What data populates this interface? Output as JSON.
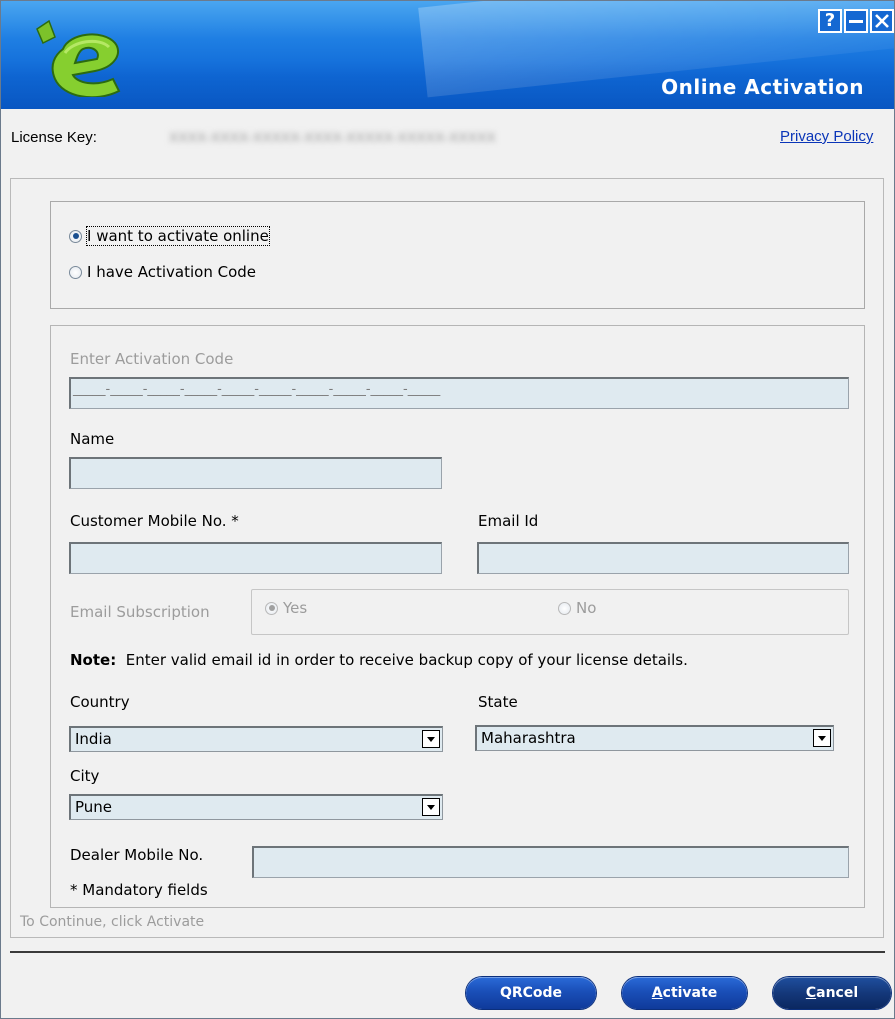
{
  "window": {
    "title": "Online Activation",
    "controls": {
      "help": "?",
      "minimize": "minimize",
      "close": "close"
    },
    "logo_icon": "e-logo-icon"
  },
  "license": {
    "label": "License Key:",
    "value_obscured": "XXXX-XXXX-XXXXX-XXXX-XXXXX-XXXXX-XXXXX",
    "privacy_link": "Privacy Policy"
  },
  "activation_mode": {
    "options": [
      {
        "label": "I want to activate online",
        "selected": true
      },
      {
        "label": "I have Activation Code",
        "selected": false
      }
    ]
  },
  "form": {
    "activation_code": {
      "label": "Enter Activation Code",
      "mask": "_____-_____-_____-_____-_____-_____-_____-_____-_____-_____"
    },
    "name": {
      "label": "Name",
      "value": ""
    },
    "mobile": {
      "label": "Customer Mobile No. *",
      "value": ""
    },
    "email": {
      "label": "Email Id",
      "value": ""
    },
    "email_subscription": {
      "label": "Email Subscription",
      "yes_label": "Yes",
      "no_label": "No",
      "selected": "Yes"
    },
    "note": {
      "prefix": "Note:",
      "text": "Enter valid email id in order to receive backup copy of your license details."
    },
    "country": {
      "label": "Country",
      "value": "India"
    },
    "state": {
      "label": "State",
      "value": "Maharashtra"
    },
    "city": {
      "label": "City",
      "value": "Pune"
    },
    "dealer_mobile": {
      "label": "Dealer Mobile No.",
      "value": ""
    },
    "mandatory_note": "* Mandatory fields"
  },
  "footer": {
    "hint": "To Continue, click Activate",
    "buttons": {
      "qrcode": "QRCode",
      "activate_first": "A",
      "activate_rest": "ctivate",
      "cancel_first": "C",
      "cancel_rest": "ancel"
    }
  },
  "colors": {
    "header_blue": "#1f7fe3",
    "field_bg": "#dfeaf0",
    "button_blue": "#1a4fb8",
    "link_blue": "#0a35b8",
    "logo_green": "#7cc22a"
  }
}
